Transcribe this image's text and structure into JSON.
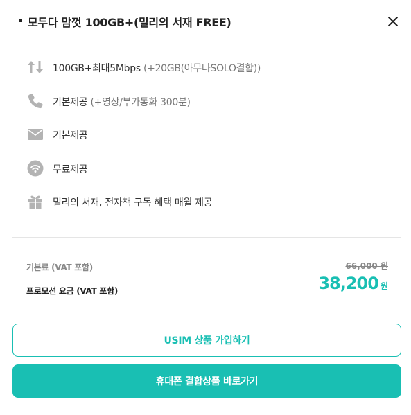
{
  "header": {
    "title": "모두다 맘껏 100GB+(밀리의 서재 FREE)"
  },
  "features": [
    {
      "icon": "data-transfer-icon",
      "text": "100GB+최대5Mbps",
      "sub": " (+20GB(아무나SOLO결합))"
    },
    {
      "icon": "phone-icon",
      "text": "기본제공",
      "sub": " (+영상/부가통화 300분)"
    },
    {
      "icon": "mail-icon",
      "text": "기본제공",
      "sub": ""
    },
    {
      "icon": "wifi-icon",
      "text": "무료제공",
      "sub": ""
    },
    {
      "icon": "gift-icon",
      "text": "밀리의 서재, 전자책 구독 혜택 매월 제공",
      "sub": ""
    }
  ],
  "pricing": {
    "base_label": "기본료 (VAT 포함)",
    "base_price": "66,000 원",
    "promo_label": "프로모션 요금 (VAT 포함)",
    "promo_price": "38,200",
    "promo_unit": "원"
  },
  "buttons": {
    "usim_label": "USIM 상품 가입하기",
    "phone_bundle_label": "휴대폰 결합상품 바로가기"
  },
  "colors": {
    "accent": "#19bfb3",
    "icon_gray": "#b3b3b3"
  }
}
